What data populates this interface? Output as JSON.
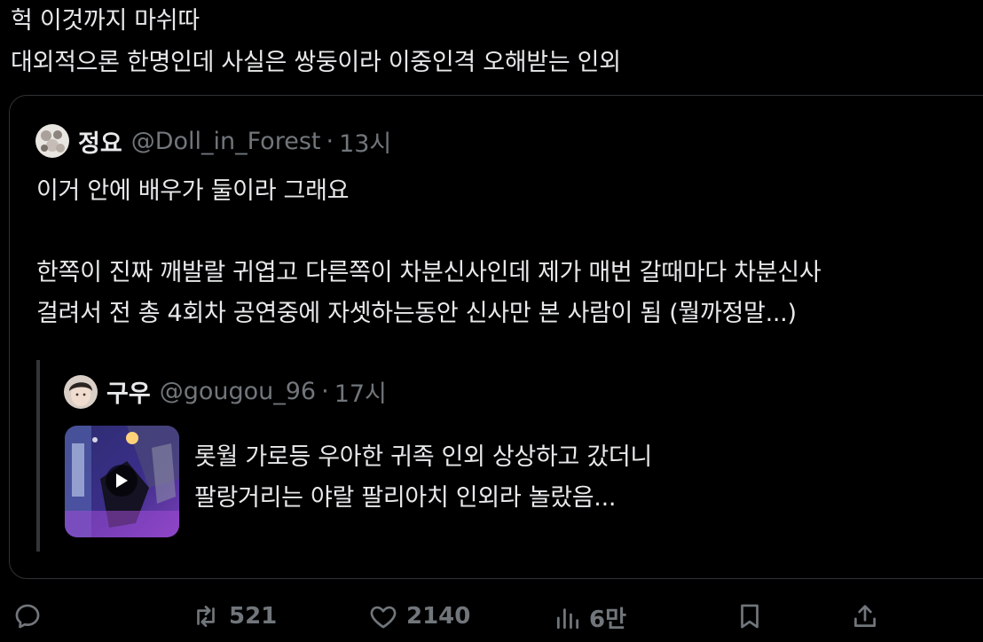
{
  "tweet": {
    "line1": "헉 이것까지 마쉬따",
    "line2": "대외적으론 한명인데 사실은 쌍둥이라 이중인격 오해받는 인외"
  },
  "quote": {
    "name": "정요",
    "handle": "@Doll_in_Forest",
    "dot": "·",
    "time": "13시",
    "body_line1": "이거 안에 배우가 둘이라 그래요",
    "body_line2": "한쪽이 진짜 깨발랄 귀엽고 다른쪽이 차분신사인데 제가 매번 갈때마다 차분신사",
    "body_line3": "걸려서 전 총 4회차 공연중에 자셋하는동안 신사만 본 사람이 됨 (뭘까정말...)",
    "nested": {
      "name": "구우",
      "handle": "@gougou_96",
      "dot": "·",
      "time": "17시",
      "text_line1": "롯월 가로등  우아한 귀족 인외 상상하고 갔더니",
      "text_line2": "팔랑거리는 야랄 팔리아치 인외라 놀랐음..."
    }
  },
  "actions": {
    "retweets": "521",
    "likes": "2140",
    "views": "6만"
  },
  "colors": {
    "background": "#000000",
    "text": "#e7e9ea",
    "muted": "#71767b",
    "border": "#2f3336"
  },
  "icons": [
    "reply-icon",
    "retweet-icon",
    "like-icon",
    "views-icon",
    "bookmark-icon",
    "share-icon",
    "play-icon"
  ]
}
